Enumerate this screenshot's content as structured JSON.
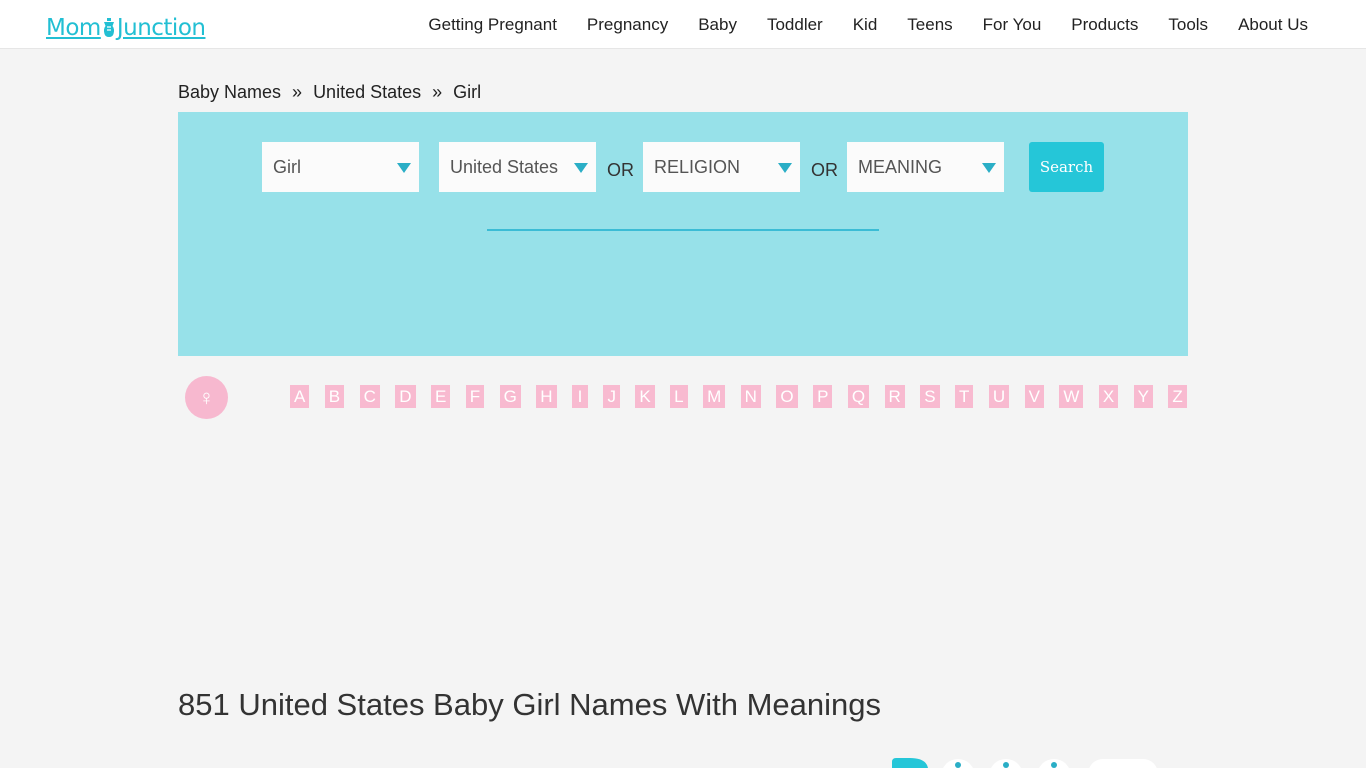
{
  "header": {
    "logo": {
      "left": "Mom",
      "right": "Junction",
      "icon": "baby-bottle-icon"
    },
    "nav": [
      "Getting Pregnant",
      "Pregnancy",
      "Baby",
      "Toddler",
      "Kid",
      "Teens",
      "For You",
      "Products",
      "Tools",
      "About Us"
    ]
  },
  "breadcrumb": {
    "items": [
      "Baby Names",
      "United States",
      "Girl"
    ],
    "separator": "»"
  },
  "search": {
    "gender": "Girl",
    "origin": "United States",
    "religion": "RELIGION",
    "meaning": "MEANING",
    "or_text": "OR",
    "button": "Search"
  },
  "gender_symbol": "♀",
  "alphabet": [
    "A",
    "B",
    "C",
    "D",
    "E",
    "F",
    "G",
    "H",
    "I",
    "J",
    "K",
    "L",
    "M",
    "N",
    "O",
    "P",
    "Q",
    "R",
    "S",
    "T",
    "U",
    "V",
    "W",
    "X",
    "Y",
    "Z"
  ],
  "page_title": "851 United States Baby Girl Names With Meanings",
  "colors": {
    "brand": "#22bfd3",
    "panel": "#97e1e9",
    "button": "#25c6d8",
    "caret": "#2aaec6",
    "letter_chip": "#f8bad0",
    "gender_badge": "#f7b8cf"
  }
}
